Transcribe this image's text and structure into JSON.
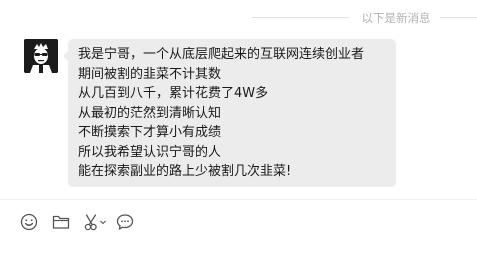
{
  "divider": {
    "text": "以下是新消息"
  },
  "message": {
    "sender_avatar": "avatar-icon",
    "lines": [
      "我是宁哥，一个从底层爬起来的互联网连续创业者",
      "期间被割的韭菜不计其数",
      "从几百到八千，累计花费了4W多",
      "从最初的茫然到清晰认知",
      "不断摸索下才算小有成绩",
      "所以我希望认识宁哥的人",
      "能在探索副业的路上少被割几次韭菜!"
    ]
  },
  "toolbar": {
    "items": [
      "emoji-icon",
      "folder-icon",
      "scissors-icon",
      "chat-bubble-icon"
    ]
  },
  "colors": {
    "bubble_bg": "#ececec",
    "divider_text": "#b2b2b2",
    "icon_stroke": "#555555"
  }
}
